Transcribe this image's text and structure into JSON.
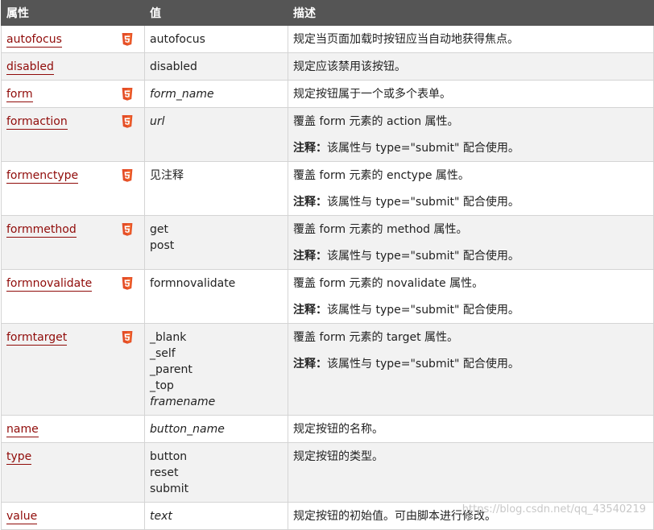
{
  "headers": {
    "attribute": "属性",
    "value": "值",
    "description": "描述"
  },
  "rows": [
    {
      "attr": "autofocus",
      "html5": true,
      "values": [
        {
          "text": "autofocus",
          "italic": false
        }
      ],
      "desc": "规定当页面加载时按钮应当自动地获得焦点。",
      "note": null
    },
    {
      "attr": "disabled",
      "html5": false,
      "values": [
        {
          "text": "disabled",
          "italic": false
        }
      ],
      "desc": "规定应该禁用该按钮。",
      "note": null
    },
    {
      "attr": "form",
      "html5": true,
      "values": [
        {
          "text": "form_name",
          "italic": true
        }
      ],
      "desc": "规定按钮属于一个或多个表单。",
      "note": null
    },
    {
      "attr": "formaction",
      "html5": true,
      "values": [
        {
          "text": "url",
          "italic": true
        }
      ],
      "desc": "覆盖 form 元素的 action 属性。",
      "note": {
        "label": "注释：",
        "text": "该属性与 type=\"submit\" 配合使用。"
      }
    },
    {
      "attr": "formenctype",
      "html5": true,
      "values": [
        {
          "text": "见注释",
          "italic": false
        }
      ],
      "desc": "覆盖 form 元素的 enctype 属性。",
      "note": {
        "label": "注释：",
        "text": "该属性与 type=\"submit\" 配合使用。"
      }
    },
    {
      "attr": "formmethod",
      "html5": true,
      "values": [
        {
          "text": "get",
          "italic": false
        },
        {
          "text": "post",
          "italic": false
        }
      ],
      "desc": "覆盖 form 元素的 method 属性。",
      "note": {
        "label": "注释：",
        "text": "该属性与 type=\"submit\" 配合使用。"
      }
    },
    {
      "attr": "formnovalidate",
      "html5": true,
      "values": [
        {
          "text": "formnovalidate",
          "italic": false
        }
      ],
      "desc": "覆盖 form 元素的 novalidate 属性。",
      "note": {
        "label": "注释：",
        "text": "该属性与 type=\"submit\" 配合使用。"
      }
    },
    {
      "attr": "formtarget",
      "html5": true,
      "values": [
        {
          "text": "_blank",
          "italic": false
        },
        {
          "text": "_self",
          "italic": false
        },
        {
          "text": "_parent",
          "italic": false
        },
        {
          "text": "_top",
          "italic": false
        },
        {
          "text": "framename",
          "italic": true
        }
      ],
      "desc": "覆盖 form 元素的 target 属性。",
      "note": {
        "label": "注释：",
        "text": "该属性与 type=\"submit\" 配合使用。"
      }
    },
    {
      "attr": "name",
      "html5": false,
      "values": [
        {
          "text": "button_name",
          "italic": true
        }
      ],
      "desc": "规定按钮的名称。",
      "note": null
    },
    {
      "attr": "type",
      "html5": false,
      "values": [
        {
          "text": "button",
          "italic": false
        },
        {
          "text": "reset",
          "italic": false
        },
        {
          "text": "submit",
          "italic": false
        }
      ],
      "desc": "规定按钮的类型。",
      "note": null
    },
    {
      "attr": "value",
      "html5": false,
      "values": [
        {
          "text": "text",
          "italic": true
        }
      ],
      "desc": "规定按钮的初始值。可由脚本进行修改。",
      "note": null
    }
  ],
  "watermark": "https://blog.csdn.net/qq_43540219",
  "colors": {
    "header_bg": "#555555",
    "link": "#900b09",
    "html5_badge": "#e44d26",
    "row_alt": "#f2f2f2",
    "border": "#d4d4d4"
  }
}
